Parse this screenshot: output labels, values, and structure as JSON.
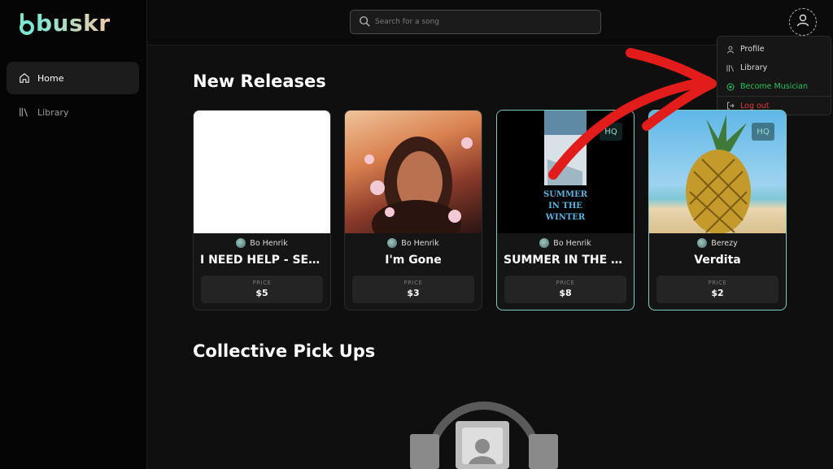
{
  "app": {
    "name": "buskr"
  },
  "sidebar": {
    "items": [
      {
        "label": "Home",
        "icon": "home-icon",
        "active": true
      },
      {
        "label": "Library",
        "icon": "library-icon",
        "active": false
      }
    ]
  },
  "search": {
    "placeholder": "Search for a song",
    "value": ""
  },
  "user_menu": {
    "items": [
      {
        "label": "Profile",
        "icon": "user-icon"
      },
      {
        "label": "Library",
        "icon": "library-icon"
      },
      {
        "label": "Become Musician",
        "icon": "circle-check-icon"
      },
      {
        "label": "Log out",
        "icon": "logout-icon"
      }
    ]
  },
  "sections": {
    "new_releases": "New Releases",
    "collective": "Collective Pick Ups"
  },
  "releases": [
    {
      "artist": "Bo Henrik",
      "title": "I NEED HELP - SECRET...",
      "price_label": "PRICE",
      "price": "$5",
      "hq": false
    },
    {
      "artist": "Bo Henrik",
      "title": "I'm Gone",
      "price_label": "PRICE",
      "price": "$3",
      "hq": false
    },
    {
      "artist": "Bo Henrik",
      "title": "SUMMER IN THE WINT...",
      "price_label": "PRICE",
      "price": "$8",
      "hq": true,
      "badge": "HQ",
      "cover_text": "SUMMER IN THE WINTER"
    },
    {
      "artist": "Berezy",
      "title": "Verdita",
      "price_label": "PRICE",
      "price": "$2",
      "hq": true,
      "badge": "HQ"
    }
  ],
  "colors": {
    "accent": "#7ee7d4",
    "hq_border": "#7fc9be",
    "musician": "#25c25a",
    "logout": "#e03b3b",
    "arrow": "#e21b1b"
  }
}
